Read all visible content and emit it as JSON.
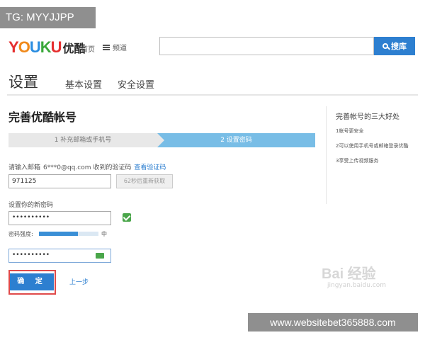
{
  "overlay_tag": "TG: MYYJJPP",
  "header": {
    "logo_letters": [
      {
        "ch": "Y",
        "color": "#e52f2f"
      },
      {
        "ch": "O",
        "color": "#f08a1c"
      },
      {
        "ch": "U",
        "color": "#2a8de0"
      },
      {
        "ch": "K",
        "color": "#3aa83a"
      },
      {
        "ch": "U",
        "color": "#e52f2f"
      }
    ],
    "logo_cn": "优酷",
    "nav_home": "首页",
    "nav_channels": "频道",
    "search_button": "搜库"
  },
  "settings": {
    "title": "设置",
    "tab_basic": "基本设置",
    "tab_security": "安全设置"
  },
  "form": {
    "title": "完善优酷帐号",
    "step1": "1 补充邮箱或手机号",
    "step2": "2 设置密码",
    "email_prompt": "请输入邮箱",
    "email_masked": "6***0@qq.com 收到的验证码",
    "check_code_link": "查看验证码",
    "code_value": "971125",
    "resend_label": "62秒后重新获取",
    "new_password_label": "设置你的新密码",
    "password_value": "••••••••••",
    "strength_label": "密码强度:",
    "strength_fraction": 0.65,
    "strength_level": "中",
    "confirm_value": "••••••••••",
    "ok_button": "确 定",
    "prev_link": "上一步"
  },
  "sidebar": {
    "title": "完善帐号的三大好处",
    "items": [
      "1帐号更安全",
      "2可以使用手机号或邮箱登录优酷",
      "3享受上传视频服务"
    ]
  },
  "watermarks": {
    "baidu": "Bai 经验",
    "baidu_url": "jingyan.baidu.com",
    "site": "www.websitebet365888.com"
  }
}
